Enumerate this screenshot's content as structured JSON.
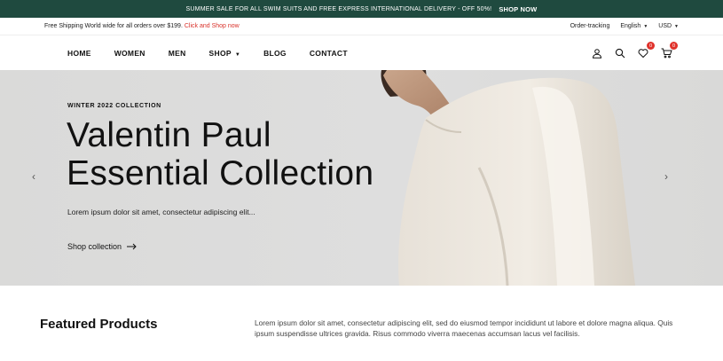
{
  "announcement": {
    "text": "SUMMER SALE FOR ALL SWIM SUITS AND FREE EXPRESS INTERNATIONAL DELIVERY - OFF 50%!",
    "cta": "SHOP NOW"
  },
  "utility": {
    "promo_text": "Free Shipping World wide for all orders over $199.",
    "promo_link": "Click and Shop now",
    "order_tracking": "Order-tracking",
    "language": "English",
    "currency": "USD"
  },
  "nav": {
    "items": [
      {
        "label": "HOME"
      },
      {
        "label": "WOMEN"
      },
      {
        "label": "MEN"
      },
      {
        "label": "SHOP"
      },
      {
        "label": "BLOG"
      },
      {
        "label": "CONTACT"
      }
    ],
    "wishlist_count": "0",
    "cart_count": "0",
    "icons": [
      "user-icon",
      "search-icon",
      "heart-icon",
      "cart-icon"
    ]
  },
  "hero": {
    "eyebrow": "WINTER 2022 COLLECTION",
    "title_line1": "Valentin Paul",
    "title_line2": "Essential Collection",
    "subtitle": "Lorem ipsum dolor sit amet, consectetur adipiscing elit...",
    "cta": "Shop collection",
    "prev_arrow": "‹",
    "next_arrow": "›"
  },
  "featured": {
    "title": "Featured Products",
    "description": "Lorem ipsum dolor sit amet, consectetur adipiscing elit, sed do eiusmod tempor incididunt ut labore et dolore magna aliqua. Quis ipsum suspendisse ultrices gravida. Risus commodo viverra maecenas accumsan lacus vel facilisis."
  },
  "colors": {
    "announcement_bg": "#1f4a3f",
    "accent": "#d9322b",
    "hero_bg": "#dcdcdb"
  }
}
